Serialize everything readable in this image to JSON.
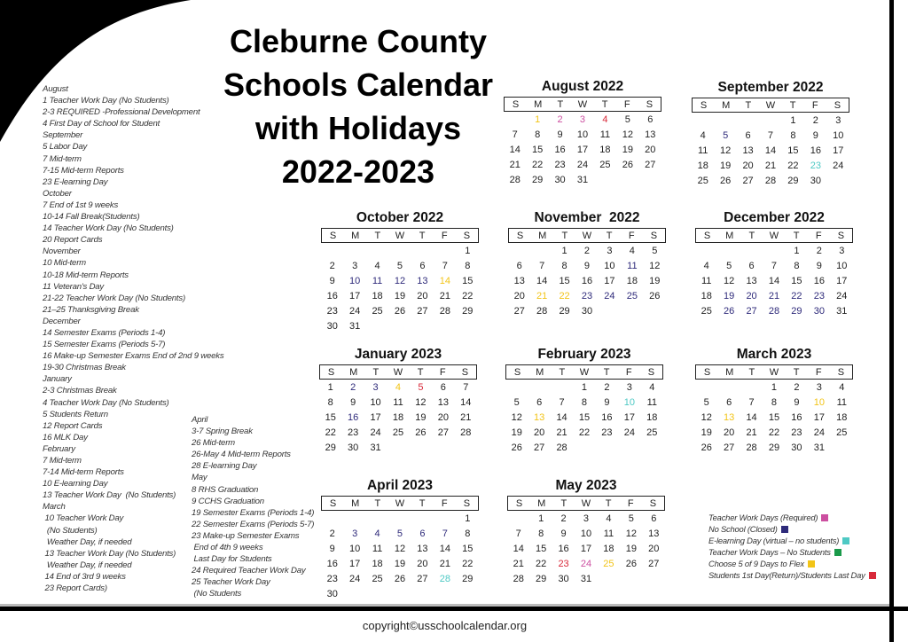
{
  "title_lines": [
    "Cleburne County",
    "Schools Calendar",
    "with Holidays",
    "2022-2023"
  ],
  "notes_left": [
    "August",
    "1 Teacher Work Day (No Students)",
    "2-3 REQUIRED -Professional Development",
    "4 First Day of School for Student",
    "September",
    "5 Labor Day",
    "7 Mid-term",
    "7-15 Mid-term Reports",
    "23 E-learning Day",
    "October",
    "7 End of 1st 9 weeks",
    "10-14 Fall Break(Students)",
    "14 Teacher Work Day (No Students)",
    "20 Report Cards",
    "November",
    "10 Mid-term",
    "10-18 Mid-term Reports",
    "11 Veteran's Day",
    "21-22 Teacher Work Day (No Students)",
    "21–25 Thanksgiving Break",
    "December",
    "14 Semester Exams (Periods 1-4)",
    "15 Semester Exams (Periods 5-7)",
    "16 Make-up Semester Exams End of 2nd 9 weeks",
    "19-30 Christmas Break",
    "January",
    "2-3 Christmas Break",
    "4 Teacher Work Day (No Students)",
    "5 Students Return",
    "12 Report Cards",
    "16 MLK Day",
    "February",
    "7 Mid-term",
    "7-14 Mid-term Reports",
    "10 E-learning Day",
    "13 Teacher Work Day  (No Students)",
    "March",
    " 10 Teacher Work Day",
    "  (No Students)",
    "  Weather Day, if needed",
    " 13 Teacher Work Day (No Students)",
    "  Weather Day, if needed",
    " 14 End of 3rd 9 weeks",
    " 23 Report Cards)"
  ],
  "notes_right": [
    "April",
    "3-7 Spring Break",
    "26 Mid-term",
    "26-May 4 Mid-term Reports",
    "28 E-learning Day",
    "May",
    "8 RHS Graduation",
    "9 CCHS Graduation",
    "19 Semester Exams (Periods 1-4)",
    "22 Semester Exams (Periods 5-7)",
    "23 Make-up Semester Exams",
    " End of 4th 9 weeks",
    " Last Day for Students",
    "24 Required Teacher Work Day",
    "25 Teacher Work Day",
    " (No Students"
  ],
  "weekday_labels": [
    "S",
    "M",
    "T",
    "W",
    "T",
    "F",
    "S"
  ],
  "colors": {
    "teacher_required": "#cc4fa0",
    "no_school": "#2e2a7a",
    "elearning": "#4ec9c4",
    "teacher_no_students": "#1a9a4a",
    "flex": "#f2c417",
    "student_first_last": "#d82a3a",
    "default": "#222222"
  },
  "months": [
    {
      "name": "August 2022",
      "start": 1,
      "days": 31,
      "marks": {
        "1": "flex",
        "2": "teacher_required",
        "3": "teacher_required",
        "4": "student_first_last"
      }
    },
    {
      "name": "September 2022",
      "start": 4,
      "days": 30,
      "marks": {
        "5": "no_school",
        "23": "elearning"
      }
    },
    {
      "name": "October 2022",
      "start": 6,
      "days": 31,
      "marks": {
        "10": "no_school",
        "11": "no_school",
        "12": "no_school",
        "13": "no_school",
        "14": "flex"
      }
    },
    {
      "name": "November  2022",
      "start": 2,
      "days": 30,
      "marks": {
        "11": "no_school",
        "21": "flex",
        "22": "flex",
        "23": "no_school",
        "24": "no_school",
        "25": "no_school"
      }
    },
    {
      "name": "December 2022",
      "start": 4,
      "days": 31,
      "marks": {
        "19": "no_school",
        "20": "no_school",
        "21": "no_school",
        "22": "no_school",
        "23": "no_school",
        "26": "no_school",
        "27": "no_school",
        "28": "no_school",
        "29": "no_school",
        "30": "no_school"
      }
    },
    {
      "name": "January 2023",
      "start": 0,
      "days": 31,
      "marks": {
        "2": "no_school",
        "3": "no_school",
        "4": "flex",
        "5": "student_first_last",
        "16": "no_school"
      }
    },
    {
      "name": "February 2023",
      "start": 3,
      "days": 28,
      "marks": {
        "10": "elearning",
        "13": "flex"
      }
    },
    {
      "name": "March 2023",
      "start": 3,
      "days": 31,
      "marks": {
        "10": "flex",
        "13": "flex"
      }
    },
    {
      "name": "April 2023",
      "start": 6,
      "days": 30,
      "marks": {
        "3": "no_school",
        "4": "no_school",
        "5": "no_school",
        "6": "no_school",
        "7": "no_school",
        "28": "elearning"
      }
    },
    {
      "name": "May 2023",
      "start": 1,
      "days": 31,
      "marks": {
        "23": "student_first_last",
        "24": "teacher_required",
        "25": "flex"
      }
    }
  ],
  "legend": [
    {
      "label": "Teacher Work Days (Required)",
      "key": "teacher_required"
    },
    {
      "label": "No School (Closed)",
      "key": "no_school"
    },
    {
      "label": "E-learning Day (virtual – no students)",
      "key": "elearning"
    },
    {
      "label": "Teacher Work Days – No Students",
      "key": "teacher_no_students"
    },
    {
      "label": "Choose 5 of 9 Days to Flex",
      "key": "flex"
    },
    {
      "label": "Students 1st Day(Return)/Students Last Day",
      "key": "student_first_last"
    }
  ],
  "copyright": "copyright©usschoolcalendar.org"
}
